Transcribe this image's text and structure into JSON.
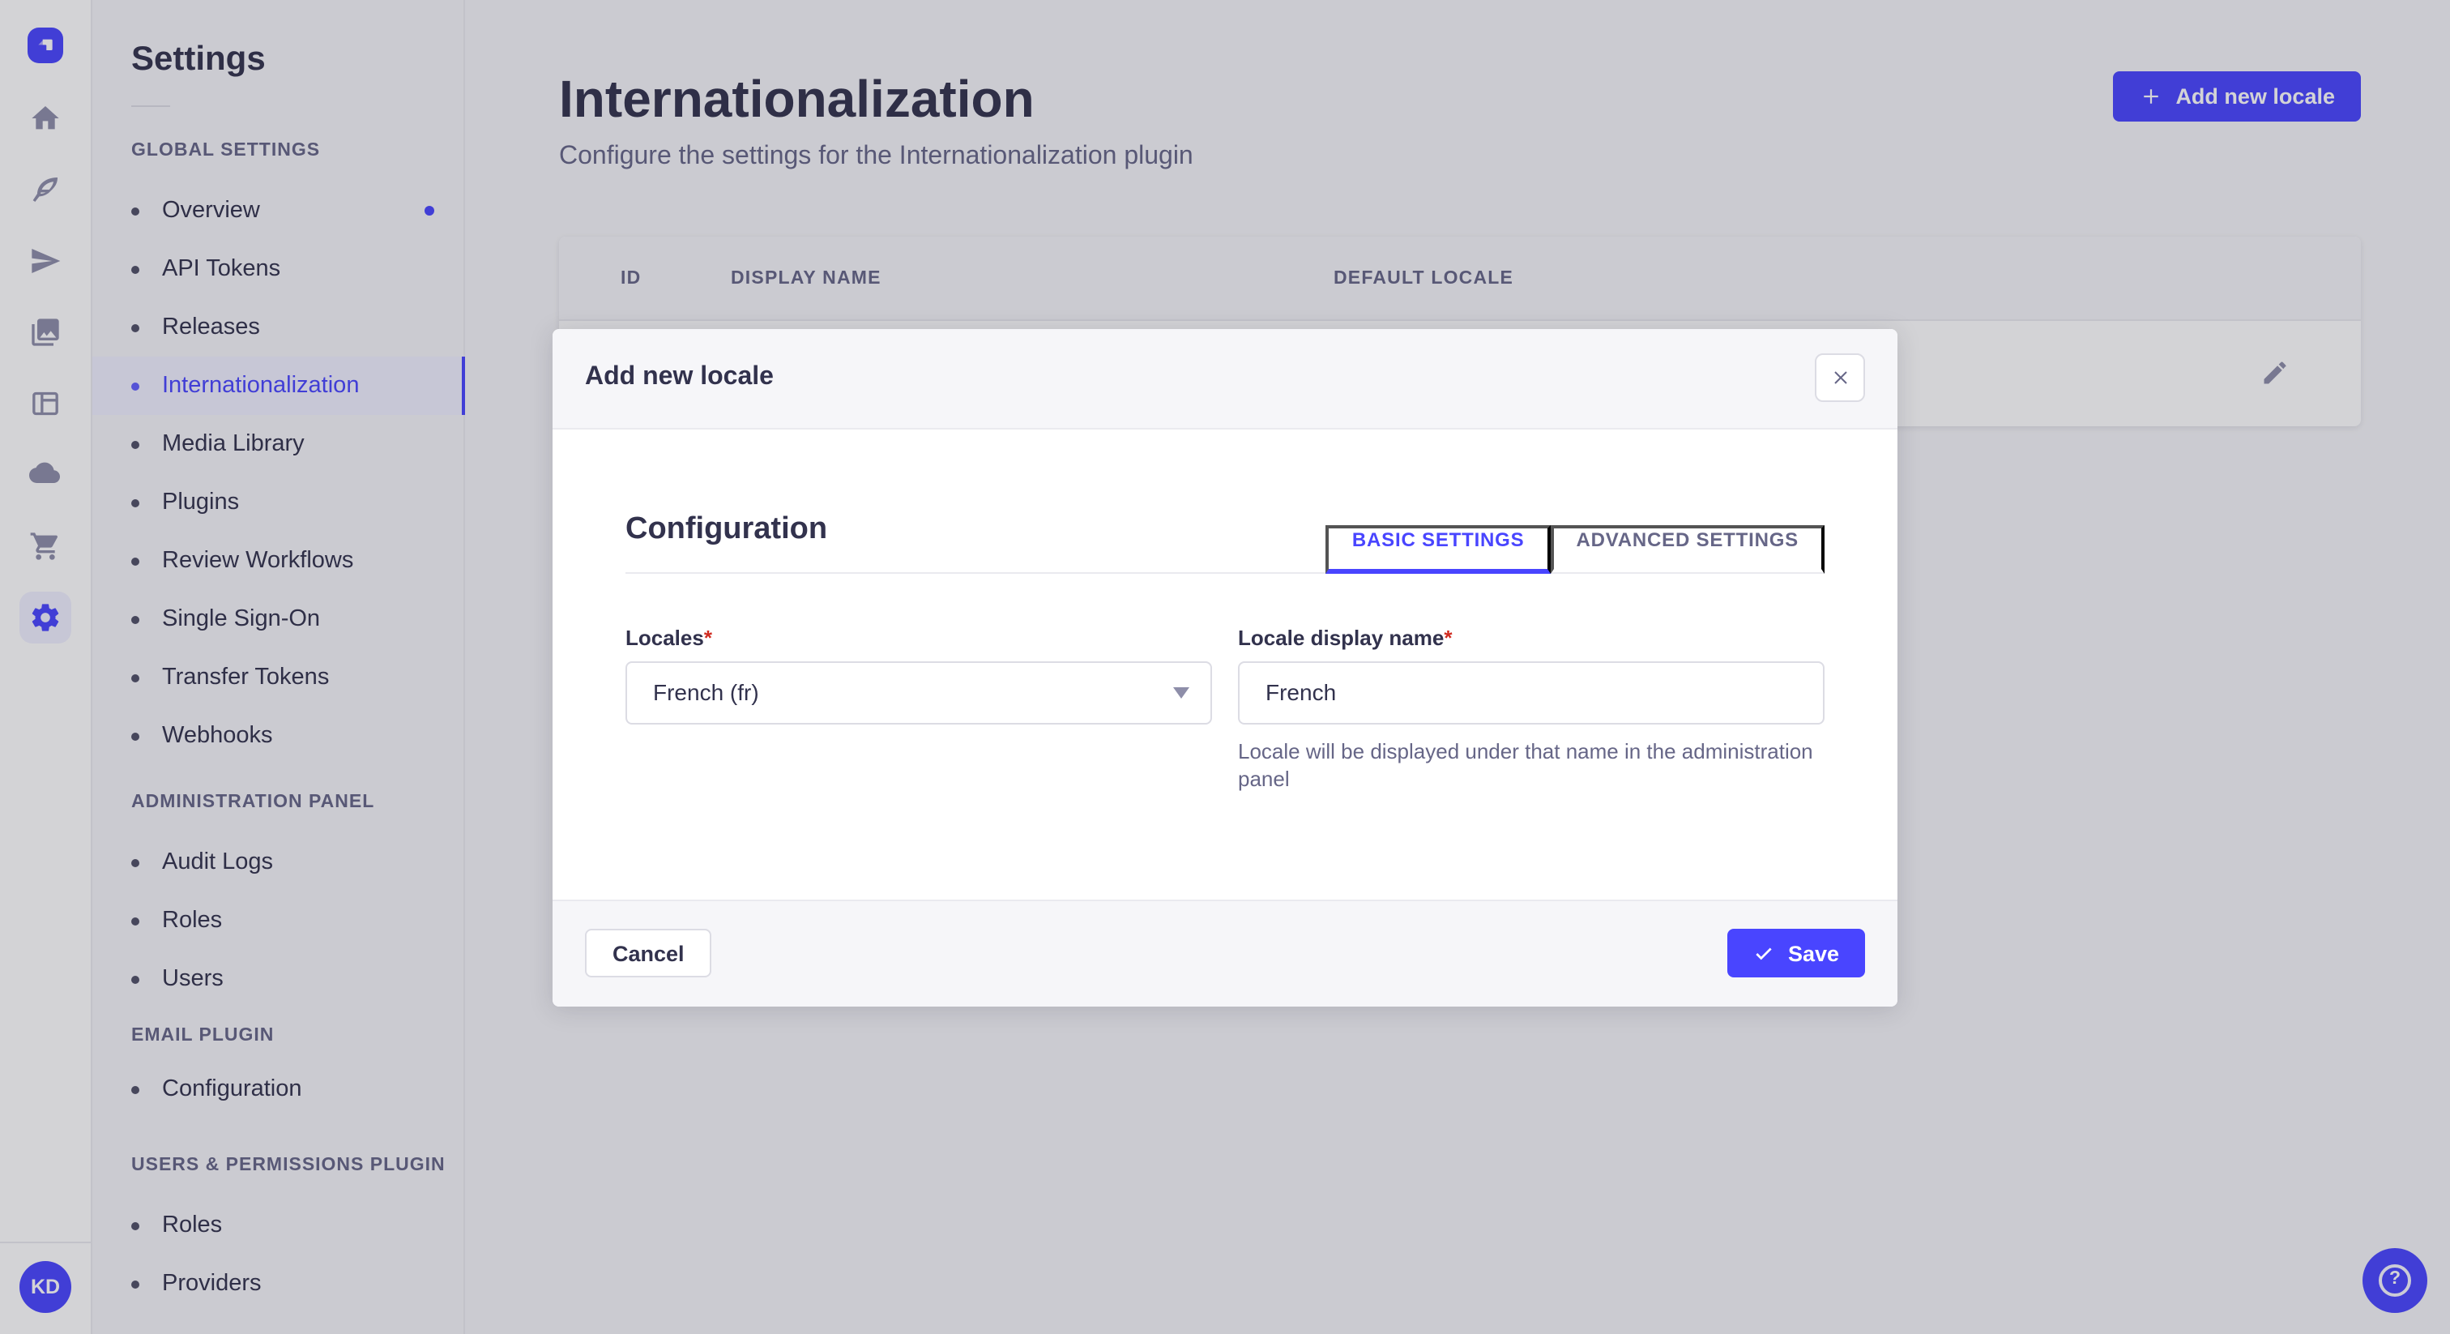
{
  "nav_rail": {
    "logo": "strapi-logo",
    "icons": [
      "home",
      "feather",
      "paper-plane",
      "media-library",
      "layout",
      "cloud",
      "cart",
      "settings"
    ],
    "active_icon": "settings",
    "avatar_initials": "KD"
  },
  "sidebar": {
    "title": "Settings",
    "sections": [
      {
        "label": "GLOBAL SETTINGS",
        "items": [
          {
            "label": "Overview",
            "notification_dot": true
          },
          {
            "label": "API Tokens"
          },
          {
            "label": "Releases"
          },
          {
            "label": "Internationalization",
            "active": true
          },
          {
            "label": "Media Library"
          },
          {
            "label": "Plugins"
          },
          {
            "label": "Review Workflows"
          },
          {
            "label": "Single Sign-On"
          },
          {
            "label": "Transfer Tokens"
          },
          {
            "label": "Webhooks"
          }
        ]
      },
      {
        "label": "ADMINISTRATION PANEL",
        "items": [
          {
            "label": "Audit Logs"
          },
          {
            "label": "Roles"
          },
          {
            "label": "Users"
          }
        ]
      },
      {
        "label": "EMAIL PLUGIN",
        "items": [
          {
            "label": "Configuration"
          }
        ]
      },
      {
        "label": "USERS & PERMISSIONS PLUGIN",
        "items": [
          {
            "label": "Roles"
          },
          {
            "label": "Providers"
          }
        ]
      }
    ]
  },
  "main": {
    "title": "Internationalization",
    "subtitle": "Configure the settings for the Internationalization plugin",
    "add_locale_button": "Add new locale",
    "table": {
      "columns": [
        "ID",
        "DISPLAY NAME",
        "DEFAULT LOCALE"
      ]
    }
  },
  "modal": {
    "title": "Add new locale",
    "section_heading": "Configuration",
    "required_mark": "*",
    "tabs": [
      {
        "label": "BASIC SETTINGS",
        "active": true
      },
      {
        "label": "ADVANCED SETTINGS",
        "active": false
      }
    ],
    "fields": {
      "locales": {
        "label": "Locales",
        "value": "French (fr)"
      },
      "display_name": {
        "label": "Locale display name",
        "value": "French",
        "helper": "Locale will be displayed under that name in the administration panel"
      }
    },
    "footer": {
      "cancel_label": "Cancel",
      "save_label": "Save"
    }
  },
  "help": {
    "glyph": "?"
  },
  "colors": {
    "primary": "#4945FF",
    "text": "#32324D",
    "subtext": "#666687",
    "border": "#DCDCE4",
    "divider": "#EAEAEF",
    "background": "#F6F6F9",
    "active_bg": "#F0F0FF",
    "danger": "#D02B20",
    "overlay": "rgba(33,33,52,0.2)"
  }
}
